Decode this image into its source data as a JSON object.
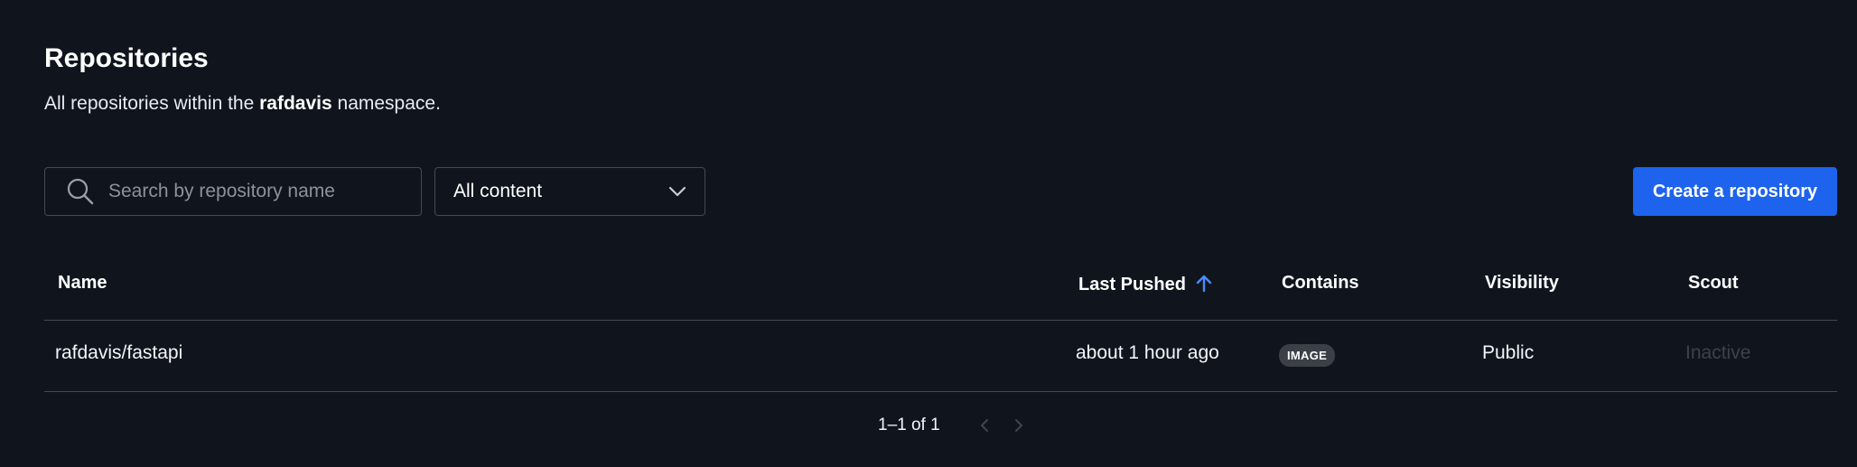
{
  "header": {
    "title": "Repositories",
    "subtitle_prefix": "All repositories within the",
    "namespace": "rafdavis",
    "subtitle_suffix": "namespace."
  },
  "toolbar": {
    "search_placeholder": "Search by repository name",
    "search_value": "",
    "filter_selected": "All content",
    "create_button": "Create a repository"
  },
  "table": {
    "columns": [
      "Name",
      "Last Pushed",
      "Contains",
      "Visibility",
      "Scout"
    ],
    "sort_column": "Last Pushed",
    "sort_direction": "ascending",
    "rows": [
      {
        "name": "rafdavis/fastapi",
        "last_pushed": "about 1 hour ago",
        "contains": "IMAGE",
        "visibility": "Public",
        "scout": "Inactive"
      }
    ]
  },
  "pagination": {
    "label": "1–1 of 1"
  },
  "colors": {
    "background": "#10151d",
    "accent": "#1d63ed",
    "border": "#424a55"
  },
  "icons": {
    "search": "search-icon",
    "dropdown": "chevron-down-icon",
    "sort": "arrow-up-icon",
    "prev": "chevron-left-icon",
    "next": "chevron-right-icon"
  }
}
